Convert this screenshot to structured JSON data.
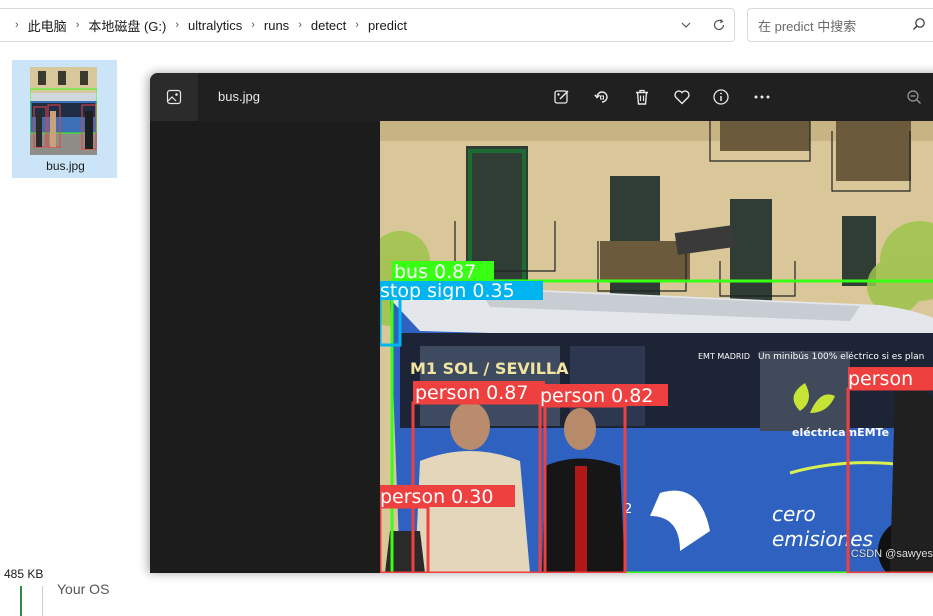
{
  "explorer": {
    "breadcrumb": [
      "此电脑",
      "本地磁盘 (G:)",
      "ultralytics",
      "runs",
      "detect",
      "predict"
    ],
    "search_placeholder": "在 predict 中搜索",
    "file": {
      "name": "bus.jpg"
    },
    "status_size": "485 KB",
    "background_text": "Your OS"
  },
  "viewer": {
    "title": "bus.jpg",
    "toolbar": [
      "edit-icon",
      "rotate-icon",
      "delete-icon",
      "favorite-icon",
      "info-icon",
      "more-icon",
      "zoom-out-icon"
    ]
  },
  "photo": {
    "bus_text": {
      "destination": "M1 SOL / SEVILLA",
      "brand": "EMT MADRID",
      "slogan": "Un minibús 100% eléctrico si es plan",
      "logo_text": "eléctricamEMTe",
      "side_text_1": "cero",
      "side_text_2": "emisiones",
      "plate": "2"
    },
    "detections": [
      {
        "label": "bus 0.87",
        "color": "#39ff14"
      },
      {
        "label": "stop sign 0.35",
        "color": "#00b4f0"
      },
      {
        "label": "person 0.87",
        "color": "#ef4040"
      },
      {
        "label": "person 0.82",
        "color": "#ef4040"
      },
      {
        "label": "person",
        "color": "#ef4040"
      },
      {
        "label": "person 0.30",
        "color": "#ef4040"
      }
    ],
    "watermark": "CSDN @sawyes"
  }
}
